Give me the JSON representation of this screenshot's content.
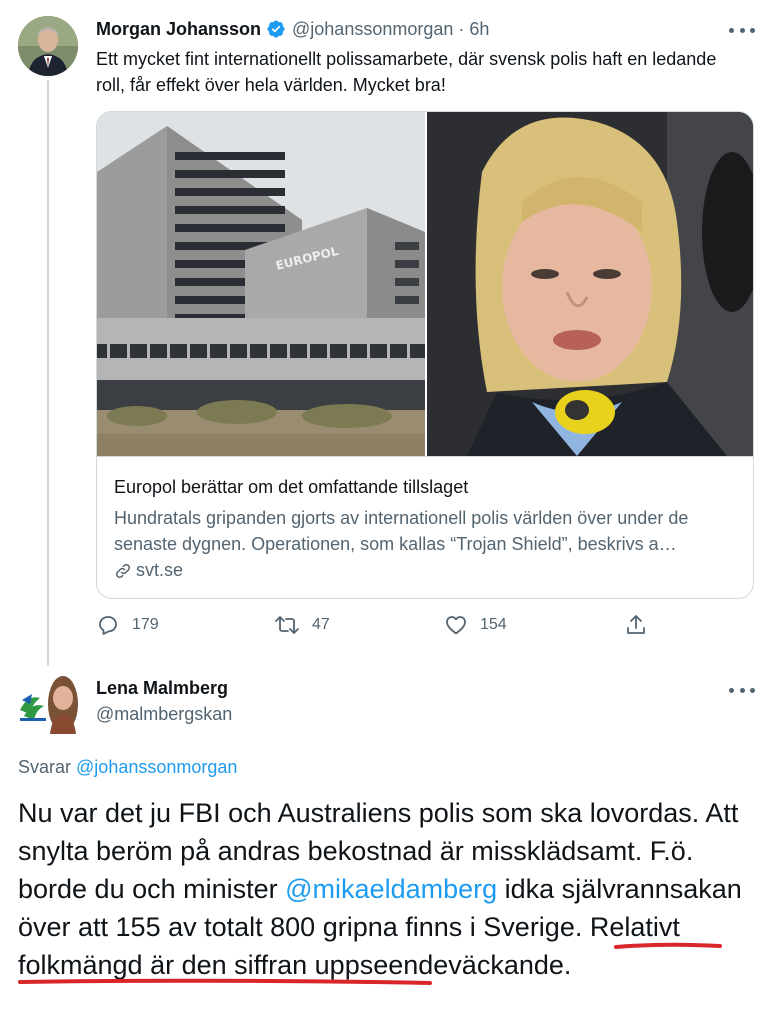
{
  "tweet": {
    "author_name": "Morgan Johansson",
    "handle": "@johanssonmorgan",
    "separator": "·",
    "time": "6h",
    "text": "Ett mycket fint internationellt polissamarbete, där svensk polis haft en ledande roll, får effekt över hela världen. Mycket bra!",
    "card": {
      "image_left_sign": "EUROPOL",
      "title": "Europol berättar om det omfattande tillslaget",
      "description": "Hundratals gripanden gjorts av internationell polis världen över under de senaste dygnen. Operationen, som kallas “Trojan Shield”, beskrivs a…",
      "domain": "svt.se"
    },
    "stats": {
      "replies": "179",
      "retweets": "47",
      "likes": "154"
    }
  },
  "reply": {
    "author_name": "Lena Malmberg",
    "handle": "@malmbergskan",
    "replying_label": "Svarar",
    "replying_to": "@johanssonmorgan",
    "text_part1": "Nu var det ju FBI och Australiens polis som ska lovordas. Att snylta beröm på andras bekostnad är missklädsamt. F.ö. borde du och minister ",
    "mention": "@mikaeldamberg",
    "text_part2": " idka självrannsakan över att 155 av totalt 800 gripna finns i Sverige. Relativt folkmängd är den siffran uppseendeväckande."
  },
  "colors": {
    "accent_blue": "#1d9bf0",
    "secondary_text": "#536471",
    "border": "#cfd9de",
    "highlight_underline": "#d8262b"
  },
  "icons": [
    "verified-badge-icon",
    "more-icon",
    "link-icon",
    "reply-icon",
    "retweet-icon",
    "like-icon",
    "share-icon"
  ]
}
